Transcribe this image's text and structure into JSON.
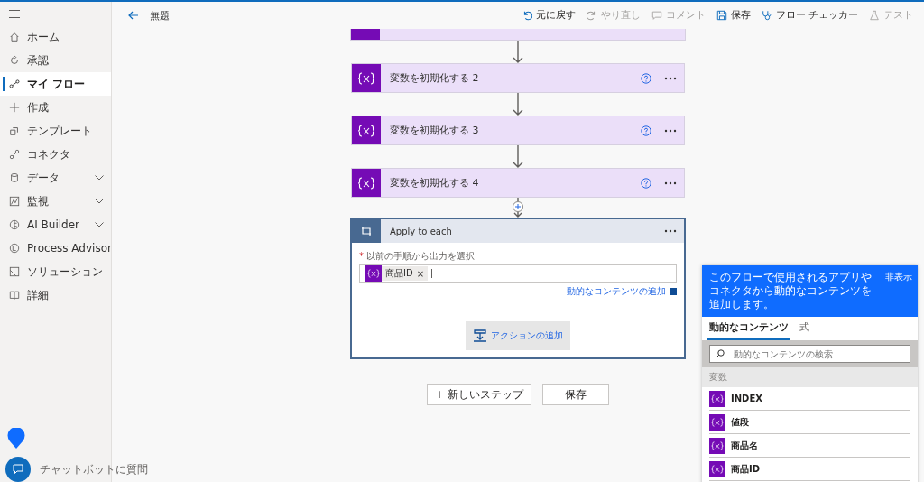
{
  "sidebar": {
    "items": [
      {
        "label": "ホーム",
        "selected": false,
        "expandable": false
      },
      {
        "label": "承認",
        "selected": false,
        "expandable": false
      },
      {
        "label": "マイ フロー",
        "selected": true,
        "expandable": false
      },
      {
        "label": "作成",
        "selected": false,
        "expandable": false
      },
      {
        "label": "テンプレート",
        "selected": false,
        "expandable": false
      },
      {
        "label": "コネクタ",
        "selected": false,
        "expandable": false
      },
      {
        "label": "データ",
        "selected": false,
        "expandable": true
      },
      {
        "label": "監視",
        "selected": false,
        "expandable": true
      },
      {
        "label": "AI Builder",
        "selected": false,
        "expandable": true
      },
      {
        "label": "Process Advisor",
        "selected": false,
        "expandable": false
      },
      {
        "label": "ソリューション",
        "selected": false,
        "expandable": false
      },
      {
        "label": "詳細",
        "selected": false,
        "expandable": false
      }
    ],
    "chatbot": "チャットボットに質問"
  },
  "header": {
    "title": "無題",
    "actions": [
      {
        "label": "元に戻す",
        "disabled": false
      },
      {
        "label": "やり直し",
        "disabled": true
      },
      {
        "label": "コメント",
        "disabled": true
      },
      {
        "label": "保存",
        "disabled": false
      },
      {
        "label": "フロー チェッカー",
        "disabled": false
      },
      {
        "label": "テスト",
        "disabled": true
      }
    ]
  },
  "flow": {
    "steps": [
      {
        "title": "変数を初期化する 2"
      },
      {
        "title": "変数を初期化する 3"
      },
      {
        "title": "変数を初期化する 4"
      }
    ],
    "loop": {
      "title": "Apply to each",
      "field_label": "以前の手順から出力を選択",
      "required_mark": "*",
      "token": "商品ID",
      "token_remove": "×",
      "add_dynamic": "動的なコンテンツの追加",
      "add_action": "アクションの追加"
    },
    "buttons": [
      "+ 新しいステップ",
      "保存"
    ]
  },
  "panel": {
    "info": "このフローで使用されるアプリやコネクタから動的なコンテンツを追加します。",
    "hide": "非表示",
    "tabs": [
      {
        "label": "動的なコンテンツ",
        "selected": true
      },
      {
        "label": "式",
        "selected": false
      }
    ],
    "search": {
      "placeholder": "動的なコンテンツの検索"
    },
    "section": "変数",
    "items": [
      "INDEX",
      "値段",
      "商品名",
      "商品ID"
    ]
  }
}
